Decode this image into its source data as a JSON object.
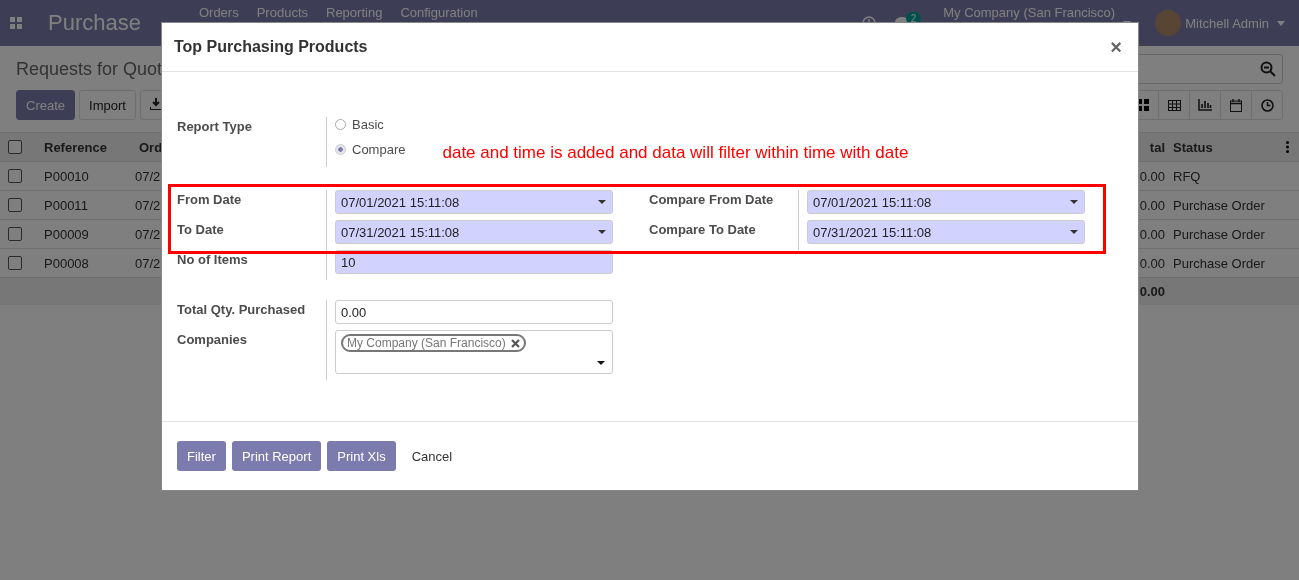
{
  "navbar": {
    "app_name": "Purchase",
    "menu": [
      "Orders",
      "Products",
      "Reporting",
      "Configuration"
    ],
    "chat_count": "2",
    "company": "My Company (San Francisco)",
    "user": "Mitchell Admin"
  },
  "control_panel": {
    "title": "Requests for Quot",
    "buttons": [
      "Create",
      "Import"
    ]
  },
  "table": {
    "header_checked": false,
    "columns_left": [
      "Reference",
      "Ord"
    ],
    "columns_right": [
      "tal",
      "Status"
    ],
    "rows": [
      {
        "checked": false,
        "reference": "P00010",
        "date": "07/2",
        "total": "0.00",
        "status": "RFQ"
      },
      {
        "checked": false,
        "reference": "P00011",
        "date": "07/2",
        "total": "0.00",
        "status": "Purchase Order"
      },
      {
        "checked": false,
        "reference": "P00009",
        "date": "07/2",
        "total": "0.00",
        "status": "Purchase Order"
      },
      {
        "checked": false,
        "reference": "P00008",
        "date": "07/2",
        "total": "0.00",
        "status": "Purchase Order"
      }
    ],
    "footer_total": "0.00"
  },
  "dialog": {
    "title": "Top Purchasing Products",
    "close": "×",
    "report_type": {
      "label": "Report Type",
      "options": [
        {
          "label": "Basic",
          "selected": false
        },
        {
          "label": "Compare",
          "selected": true
        }
      ]
    },
    "annotation": "date and time is added and data will filter within time with date",
    "date_rows": [
      {
        "label": "From Date",
        "value": "07/01/2021 15:11:08",
        "compare_label": "Compare From Date",
        "compare_value": "07/01/2021 15:11:08"
      },
      {
        "label": "To Date",
        "value": "07/31/2021 15:11:08",
        "compare_label": "Compare To Date",
        "compare_value": "07/31/2021 15:11:08"
      }
    ],
    "items": {
      "label": "No of Items",
      "value": "10"
    },
    "total_qty": {
      "label": "Total Qty. Purchased",
      "value": "0.00"
    },
    "companies": {
      "label": "Companies",
      "tags": [
        "My Company (San Francisco)"
      ]
    },
    "buttons": [
      {
        "label": "Filter",
        "kind": "primary"
      },
      {
        "label": "Print Report",
        "kind": "primary"
      },
      {
        "label": "Print Xls",
        "kind": "primary"
      },
      {
        "label": "Cancel",
        "kind": "link"
      }
    ]
  }
}
